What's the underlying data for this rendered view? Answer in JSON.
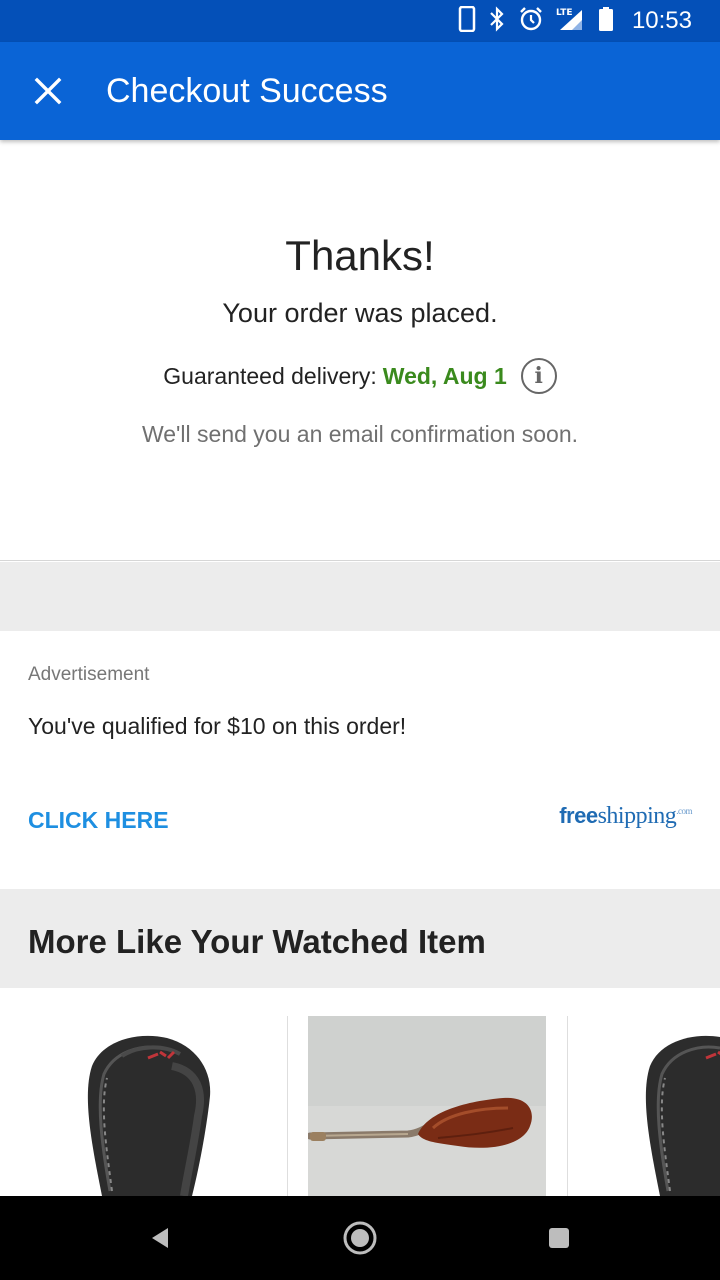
{
  "status_bar": {
    "time": "10:53",
    "network": "LTE",
    "icons": [
      "phone-icon",
      "bluetooth-icon",
      "alarm-icon",
      "signal-icon",
      "battery-icon"
    ]
  },
  "app_bar": {
    "title": "Checkout Success",
    "close_icon": "close-icon"
  },
  "confirmation": {
    "heading": "Thanks!",
    "message": "Your order was placed.",
    "delivery_label": "Guaranteed delivery:",
    "delivery_date": "Wed, Aug 1",
    "email_note": "We'll send you an email confirmation soon.",
    "info_icon": "info-icon"
  },
  "advertisement": {
    "label": "Advertisement",
    "message": "You've qualified for $10 on this order!",
    "cta": "CLICK HERE",
    "logo_bold": "free",
    "logo_rest": "shipping",
    "logo_suffix": ".com"
  },
  "recommendations": {
    "title": "More Like Your Watched Item",
    "items": [
      {
        "image": "black-leather-shift-knob"
      },
      {
        "image": "wooden-shift-knob"
      },
      {
        "image": "black-leather-shift-knob"
      }
    ]
  },
  "nav_bar": {
    "icons": [
      "back-icon",
      "home-icon",
      "recents-icon"
    ]
  },
  "colors": {
    "status_bar": "#0450b8",
    "app_bar": "#0a64d6",
    "delivery_date": "#3a8a1d",
    "cta": "#1e8fe1",
    "section_bg": "#ececec"
  }
}
